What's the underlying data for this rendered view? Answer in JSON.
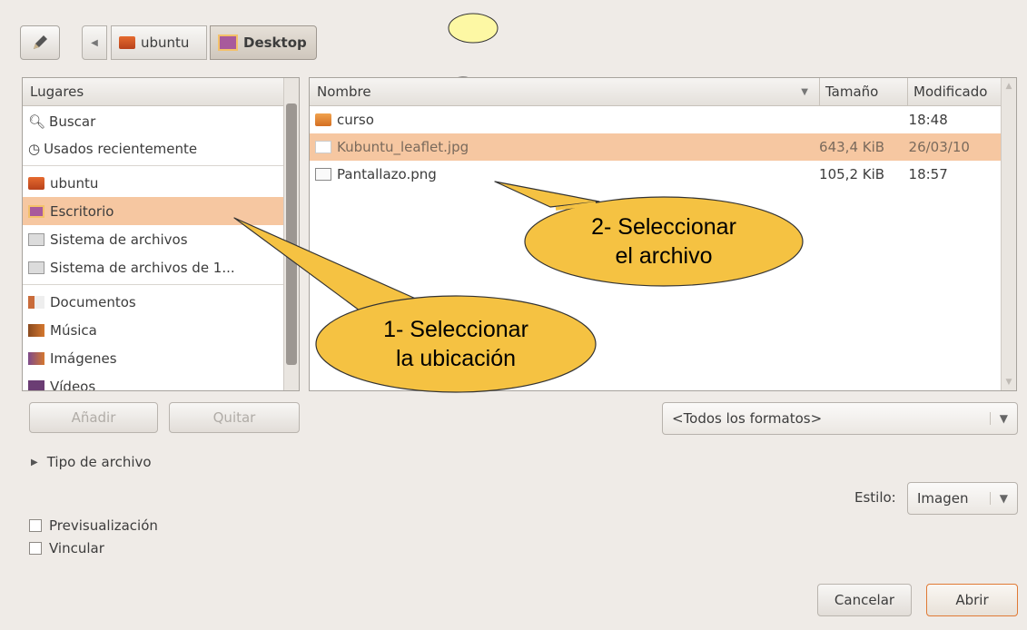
{
  "toolbar": {
    "edit_icon": "pencil-icon",
    "back_icon": "left-arrow-icon"
  },
  "path": [
    {
      "label": "ubuntu",
      "icon": "home-folder-icon"
    },
    {
      "label": "Desktop",
      "icon": "desktop-folder-icon"
    }
  ],
  "places": {
    "header": "Lugares",
    "items": [
      {
        "label": "Buscar",
        "icon": "search-icon"
      },
      {
        "label": "Usados recientemente",
        "icon": "recent-icon"
      },
      {
        "label": "ubuntu",
        "icon": "home-folder-icon"
      },
      {
        "label": "Escritorio",
        "icon": "desktop-folder-icon"
      },
      {
        "label": "Sistema de archivos",
        "icon": "drive-icon"
      },
      {
        "label": "Sistema de archivos de 1...",
        "icon": "drive-icon"
      },
      {
        "label": "Documentos",
        "icon": "documents-folder-icon"
      },
      {
        "label": "Música",
        "icon": "music-folder-icon"
      },
      {
        "label": "Imágenes",
        "icon": "pictures-folder-icon"
      },
      {
        "label": "Vídeos",
        "icon": "videos-folder-icon"
      }
    ],
    "add": "Añadir",
    "remove": "Quitar"
  },
  "files": {
    "columns": {
      "name": "Nombre",
      "size": "Tamaño",
      "modified": "Modificado"
    },
    "rows": [
      {
        "name": "curso",
        "size": "",
        "modified": "18:48",
        "icon": "folder-icon"
      },
      {
        "name": "Kubuntu_leaflet.jpg",
        "size": "643,4 KiB",
        "modified": "26/03/10",
        "icon": "image-file-icon"
      },
      {
        "name": "Pantallazo.png",
        "size": "105,2 KiB",
        "modified": "18:57",
        "icon": "image-file-icon"
      }
    ]
  },
  "filter": "<Todos los formatos>",
  "file_type_label": "Tipo de archivo",
  "style_label": "Estilo:",
  "style_value": "Imagen",
  "options": {
    "preview": "Previsualización",
    "link": "Vincular"
  },
  "buttons": {
    "cancel": "Cancelar",
    "open": "Abrir"
  },
  "callouts": {
    "one_line1": "1- Seleccionar",
    "one_line2": "la ubicación",
    "two_line1": "2- Seleccionar",
    "two_line2": "el archivo"
  },
  "colors": {
    "selection": "#f6c7a1",
    "callout": "#f5c242"
  }
}
